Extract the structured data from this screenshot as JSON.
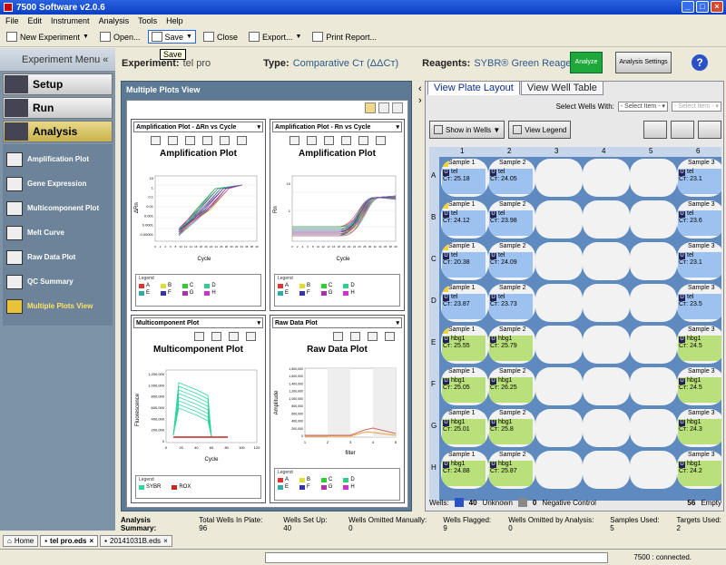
{
  "window": {
    "title": "7500 Software v2.0.6"
  },
  "menu": [
    "File",
    "Edit",
    "Instrument",
    "Analysis",
    "Tools",
    "Help"
  ],
  "toolbar": {
    "new": "New Experiment",
    "open": "Open...",
    "save": "Save",
    "close": "Close",
    "export": "Export...",
    "print": "Print Report...",
    "tooltip": "Save"
  },
  "sidebar": {
    "title": "Experiment Menu",
    "setup": "Setup",
    "run": "Run",
    "analysis": "Analysis",
    "items": [
      "Amplification Plot",
      "Gene Expression",
      "Multicomponent Plot",
      "Melt Curve",
      "Raw Data Plot",
      "QC Summary",
      "Multiple Plots View"
    ]
  },
  "header": {
    "exp_label": "Experiment:",
    "exp": "tel pro",
    "type_label": "Type:",
    "type": "Comparative Cᴛ (ΔΔCᴛ)",
    "reag_label": "Reagents:",
    "reag": "SYBR® Green Reagents",
    "analyze": "Analyze",
    "settings": "Analysis Settings"
  },
  "mpv": {
    "title": "Multiple Plots View",
    "p1": {
      "select": "Amplification Plot - ΔRn vs Cycle",
      "title": "Amplification Plot",
      "ylabel": "ΔRn",
      "xlabel": "Cycle",
      "yticks": [
        "10",
        "1",
        "0.1",
        "0.01",
        "0.001",
        "0.0001",
        "0.00001"
      ],
      "xticks": [
        "0",
        "2",
        "4",
        "6",
        "8",
        "10",
        "12",
        "14",
        "16",
        "18",
        "20",
        "22",
        "24",
        "26",
        "28",
        "30",
        "32",
        "34",
        "36",
        "38",
        "40"
      ]
    },
    "p2": {
      "select": "Amplification Plot - Rn vs Cycle",
      "title": "Amplification Plot",
      "ylabel": "Rn",
      "xlabel": "Cycle",
      "yticks": [
        "10",
        "1"
      ],
      "xticks": [
        "0",
        "2",
        "4",
        "6",
        "8",
        "10",
        "12",
        "14",
        "16",
        "18",
        "20",
        "22",
        "24",
        "26",
        "28",
        "30",
        "32",
        "34",
        "36",
        "38",
        "40"
      ]
    },
    "p3": {
      "select": "Multicomponent Plot",
      "title": "Multicomponent Plot",
      "ylabel": "Fluorescence",
      "xlabel": "Cycle",
      "yticks": [
        "1,200,000",
        "1,000,000",
        "800,000",
        "600,000",
        "400,000",
        "200,000",
        "0"
      ],
      "xticks": [
        "0",
        "20",
        "40",
        "60",
        "80",
        "100",
        "120"
      ]
    },
    "p4": {
      "select": "Raw Data Plot",
      "title": "Raw Data Plot",
      "ylabel": "Amplitude",
      "xlabel": "filter",
      "yticks": [
        "1,800,000",
        "1,600,000",
        "1,400,000",
        "1,200,000",
        "1,000,000",
        "800,000",
        "600,000",
        "400,000",
        "200,000",
        "0"
      ],
      "xticks": [
        "1",
        "2",
        "3",
        "4",
        "5"
      ]
    },
    "legend_title": "Legend",
    "legend_rows": [
      "A",
      "B",
      "C",
      "D",
      "E",
      "F",
      "G",
      "H"
    ],
    "mc_legend": [
      "SYBR",
      "ROX"
    ],
    "legend_colors": [
      "#d33",
      "#dd3",
      "#3c3",
      "#3c8",
      "#3aa",
      "#33a",
      "#a3a",
      "#c3c"
    ]
  },
  "plate": {
    "tab1": "View Plate Layout",
    "tab2": "View Well Table",
    "select_label": "Select Wells With:",
    "select": "- Select Item -",
    "select2": "- Select Item -",
    "show": "Show in Wells ▼",
    "legend": "View Legend",
    "cols": [
      "1",
      "2",
      "3",
      "4",
      "5",
      "6"
    ],
    "rows": [
      "A",
      "B",
      "C",
      "D",
      "E",
      "F",
      "G",
      "H"
    ],
    "wells": [
      {
        "n": "1",
        "s": "Sample 1",
        "t": "tel",
        "ct": "Cᴛ: 25.18",
        "u": true
      },
      {
        "s": "Sample 2",
        "t": "tel",
        "ct": "Cᴛ: 24.05",
        "u": true
      },
      {
        "s": "Sample 3",
        "t": "tel",
        "ct": "Cᴛ: 23.1",
        "u": true
      },
      {
        "n": "1",
        "s": "Sample 1",
        "t": "tel",
        "ct": "Cᴛ: 24.12",
        "u": true
      },
      {
        "s": "Sample 2",
        "t": "tel",
        "ct": "Cᴛ: 23.98",
        "u": true
      },
      {
        "s": "Sample 3",
        "t": "tel",
        "ct": "Cᴛ: 23.6",
        "u": true
      },
      {
        "n": "2",
        "s": "Sample 1",
        "t": "tel",
        "ct": "Cᴛ: 20.38",
        "u": true
      },
      {
        "s": "Sample 2",
        "t": "tel",
        "ct": "Cᴛ: 24.09",
        "u": true
      },
      {
        "s": "Sample 3",
        "t": "tel",
        "ct": "Cᴛ: 23.1",
        "u": true
      },
      {
        "n": "1",
        "s": "Sample 1",
        "t": "tel",
        "ct": "Cᴛ: 23.87",
        "u": true
      },
      {
        "s": "Sample 2",
        "t": "tel",
        "ct": "Cᴛ: 23.73",
        "u": true
      },
      {
        "s": "Sample 3",
        "t": "tel",
        "ct": "Cᴛ: 23.5",
        "u": true
      },
      {
        "n": "2",
        "s": "Sample 1",
        "t": "hbg1",
        "ct": "Cᴛ: 25.55",
        "u": false
      },
      {
        "s": "Sample 2",
        "t": "hbg1",
        "ct": "Cᴛ: 25.79",
        "u": false
      },
      {
        "s": "Sample 3",
        "t": "hbg1",
        "ct": "Cᴛ: 24.5",
        "u": false
      },
      {
        "s": "Sample 1",
        "t": "hbg1",
        "ct": "Cᴛ: 25.05",
        "u": false
      },
      {
        "s": "Sample 2",
        "t": "hbg1",
        "ct": "Cᴛ: 26.25",
        "u": false
      },
      {
        "s": "Sample 3",
        "t": "hbg1",
        "ct": "Cᴛ: 24.5",
        "u": false
      },
      {
        "s": "Sample 1",
        "t": "hbg1",
        "ct": "Cᴛ: 25.01",
        "u": false
      },
      {
        "s": "Sample 2",
        "t": "hbg1",
        "ct": "Cᴛ: 25.8",
        "u": false
      },
      {
        "s": "Sample 3",
        "t": "hbg1",
        "ct": "Cᴛ: 24.3",
        "u": false
      },
      {
        "s": "Sample 1",
        "t": "hbg1",
        "ct": "Cᴛ: 24.88",
        "u": false
      },
      {
        "s": "Sample 2",
        "t": "hbg1",
        "ct": "Cᴛ: 25.87",
        "u": false
      },
      {
        "s": "Sample 3",
        "t": "hbg1",
        "ct": "Cᴛ: 24.2",
        "u": false
      }
    ],
    "foot": {
      "wells": "Wells:",
      "unk_n": "40",
      "unk": "Unknown",
      "neg_n": "0",
      "neg": "Negative Control",
      "empty_n": "56",
      "empty": "Empty"
    }
  },
  "summary": {
    "label": "Analysis Summary:",
    "total": "Total Wells In Plate: 96",
    "setup": "Wells Set Up: 40",
    "omit_man": "Wells Omitted Manually: 0",
    "flagged": "Wells Flagged: 9",
    "omit_an": "Wells Omitted by Analysis: 0",
    "samples": "Samples Used: 5",
    "targets": "Targets Used: 2"
  },
  "filetabs": [
    "Home",
    "tel pro.eds",
    "20141031B.eds"
  ],
  "status": "7500 : connected."
}
